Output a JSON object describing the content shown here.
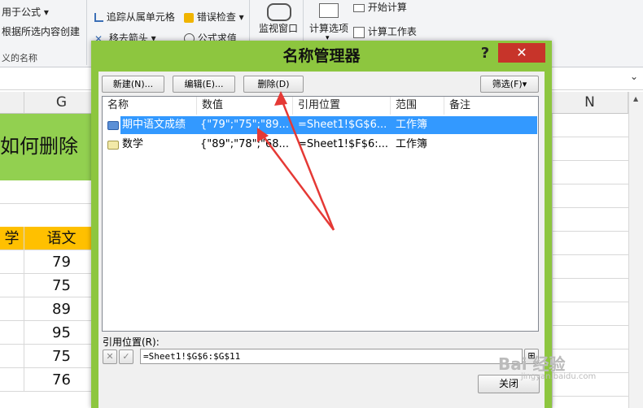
{
  "ribbon": {
    "use_in_formula": "用于公式",
    "create_from_selection": "根据所选内容创建",
    "defined_names_group": "义的名称",
    "trace_dependents": "追踪从属单元格",
    "error_checking": "错误检查",
    "remove_arrows": "移去箭头",
    "evaluate_formula": "公式求值",
    "watch_window": "监视窗口",
    "calc_options": "计算选项",
    "calc_now": "开始计算",
    "calc_sheet": "计算工作表"
  },
  "sheet": {
    "col_g": "G",
    "col_n": "N",
    "title_text": "如何删除",
    "header_partial": "学",
    "header_chinese": "语文",
    "values": [
      "79",
      "75",
      "89",
      "95",
      "75",
      "76"
    ]
  },
  "dialog": {
    "title": "名称管理器",
    "help": "?",
    "close": "✕",
    "new_btn": "新建(N)...",
    "edit_btn": "编辑(E)...",
    "delete_btn": "删除(D)",
    "filter_btn": "筛选(F)▾",
    "columns": [
      "名称",
      "数值",
      "引用位置",
      "范围",
      "备注"
    ],
    "rows": [
      {
        "name": "期中语文成绩",
        "value": "{\"79\";\"75\";\"89...",
        "ref": "=Sheet1!$G$6...",
        "scope": "工作簿",
        "comment": ""
      },
      {
        "name": "数学",
        "value": "{\"89\";\"78\";\"68...",
        "ref": "=Sheet1!$F$6:...",
        "scope": "工作簿",
        "comment": ""
      }
    ],
    "ref_label": "引用位置(R):",
    "ref_value": "=Sheet1!$G$6:$G$11",
    "close_btn": "关闭"
  },
  "watermark": "Bai 经验",
  "watermark_url": "jingyan.baidu.com",
  "colors": {
    "dialog_frame": "#8dc63f",
    "selection": "#3399ff",
    "close_red": "#c7342a",
    "title_fill": "#92d050",
    "header_fill": "#ffc000",
    "arrow": "#e53935"
  }
}
